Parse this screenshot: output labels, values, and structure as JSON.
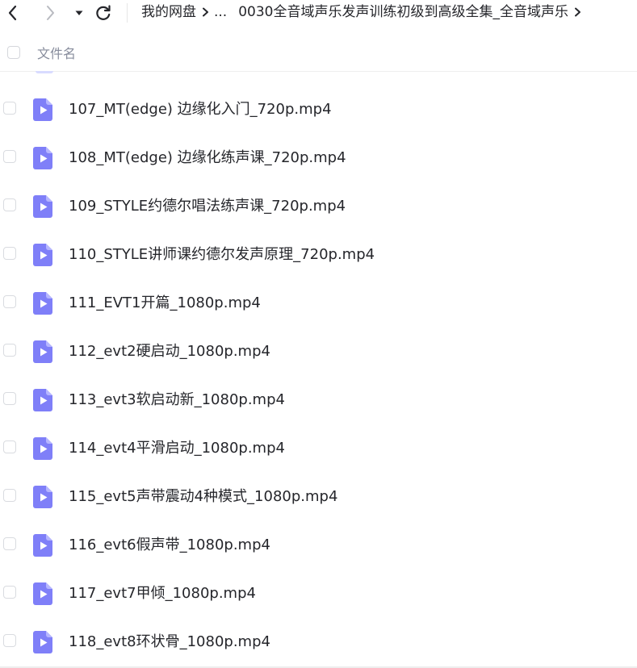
{
  "nav": {
    "back_icon": "chevron-left-icon",
    "forward_icon": "chevron-right-icon",
    "dropdown_icon": "caret-down-icon",
    "refresh_icon": "refresh-icon"
  },
  "breadcrumb": {
    "root": "我的网盘",
    "ellipsis": "...",
    "current": "0030全音域声乐发声训练初级到高级全集_全音域声乐"
  },
  "header": {
    "column_name": "文件名"
  },
  "files": [
    {
      "name": "107_MT(edge)  边缘化入门_720p.mp4",
      "icon": "video-file-icon"
    },
    {
      "name": "108_MT(edge)  边缘化练声课_720p.mp4",
      "icon": "video-file-icon"
    },
    {
      "name": "109_STYLE约德尔唱法练声课_720p.mp4",
      "icon": "video-file-icon"
    },
    {
      "name": "110_STYLE讲师课约德尔发声原理_720p.mp4",
      "icon": "video-file-icon"
    },
    {
      "name": "111_EVT1开篇_1080p.mp4",
      "icon": "video-file-icon"
    },
    {
      "name": "112_evt2硬启动_1080p.mp4",
      "icon": "video-file-icon"
    },
    {
      "name": "113_evt3软启动新_1080p.mp4",
      "icon": "video-file-icon"
    },
    {
      "name": "114_evt4平滑启动_1080p.mp4",
      "icon": "video-file-icon"
    },
    {
      "name": "115_evt5声带震动4种模式_1080p.mp4",
      "icon": "video-file-icon"
    },
    {
      "name": "116_evt6假声带_1080p.mp4",
      "icon": "video-file-icon"
    },
    {
      "name": "117_evt7甲倾_1080p.mp4",
      "icon": "video-file-icon"
    },
    {
      "name": "118_evt8环状骨_1080p.mp4",
      "icon": "video-file-icon"
    }
  ],
  "colors": {
    "icon_bg": "#7f7ff8",
    "icon_fold": "#b6b6ff",
    "text": "#25262b",
    "muted": "#878c9c"
  }
}
